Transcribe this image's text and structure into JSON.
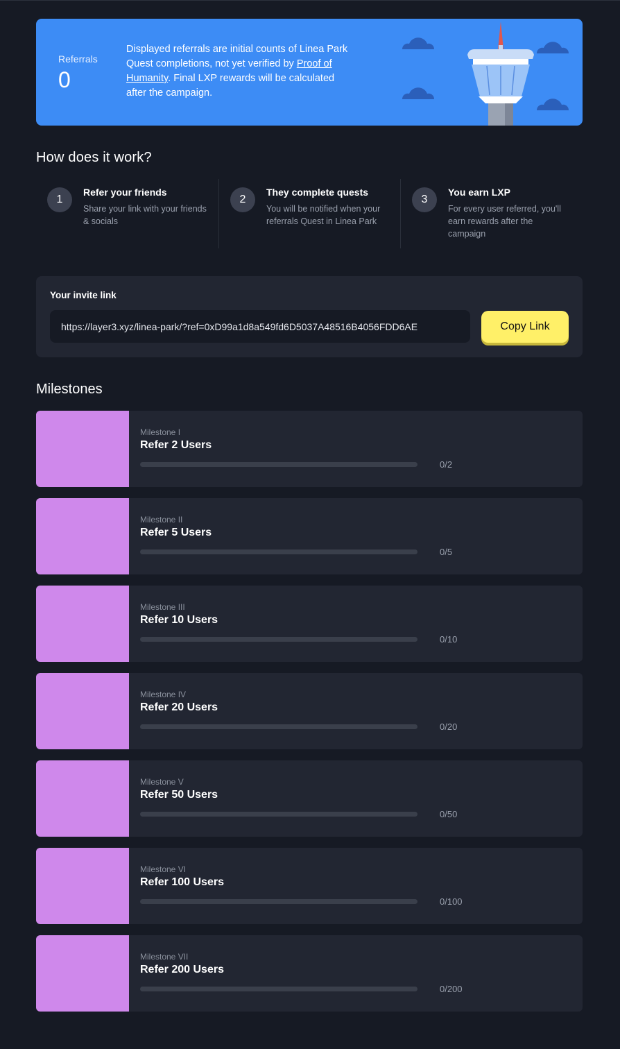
{
  "banner": {
    "referrals_label": "Referrals",
    "referrals_count": "0",
    "text_before": "Displayed referrals are initial counts of Linea Park Quest completions, not yet verified by ",
    "link_text": "Proof of Humanity",
    "text_after": ". Final LXP rewards will be calculated after the campaign.",
    "bg_color": "#3d8cf5"
  },
  "how": {
    "title": "How does it work?",
    "steps": [
      {
        "num": "1",
        "title": "Refer your friends",
        "desc": "Share your link with your friends & socials"
      },
      {
        "num": "2",
        "title": "They complete quests",
        "desc": "You will be notified when your referrals Quest in Linea Park"
      },
      {
        "num": "3",
        "title": "You earn LXP",
        "desc": "For every user referred, you'll earn rewards after the campaign"
      }
    ]
  },
  "invite": {
    "label": "Your invite link",
    "link": "https://layer3.xyz/linea-park/?ref=0xD99a1d8a549fd6D5037A48516B4056FDD6AE",
    "copy_label": "Copy Link",
    "button_color": "#fff068"
  },
  "milestones": {
    "title": "Milestones",
    "accent_color": "#cf88eb",
    "items": [
      {
        "sub": "Milestone I",
        "name": "Refer 2 Users",
        "count": "0/2",
        "progress": 0
      },
      {
        "sub": "Milestone II",
        "name": "Refer 5 Users",
        "count": "0/5",
        "progress": 0
      },
      {
        "sub": "Milestone III",
        "name": "Refer 10 Users",
        "count": "0/10",
        "progress": 0
      },
      {
        "sub": "Milestone IV",
        "name": "Refer 20 Users",
        "count": "0/20",
        "progress": 0
      },
      {
        "sub": "Milestone V",
        "name": "Refer 50 Users",
        "count": "0/50",
        "progress": 0
      },
      {
        "sub": "Milestone VI",
        "name": "Refer 100 Users",
        "count": "0/100",
        "progress": 0
      },
      {
        "sub": "Milestone VII",
        "name": "Refer 200 Users",
        "count": "0/200",
        "progress": 0
      }
    ]
  }
}
